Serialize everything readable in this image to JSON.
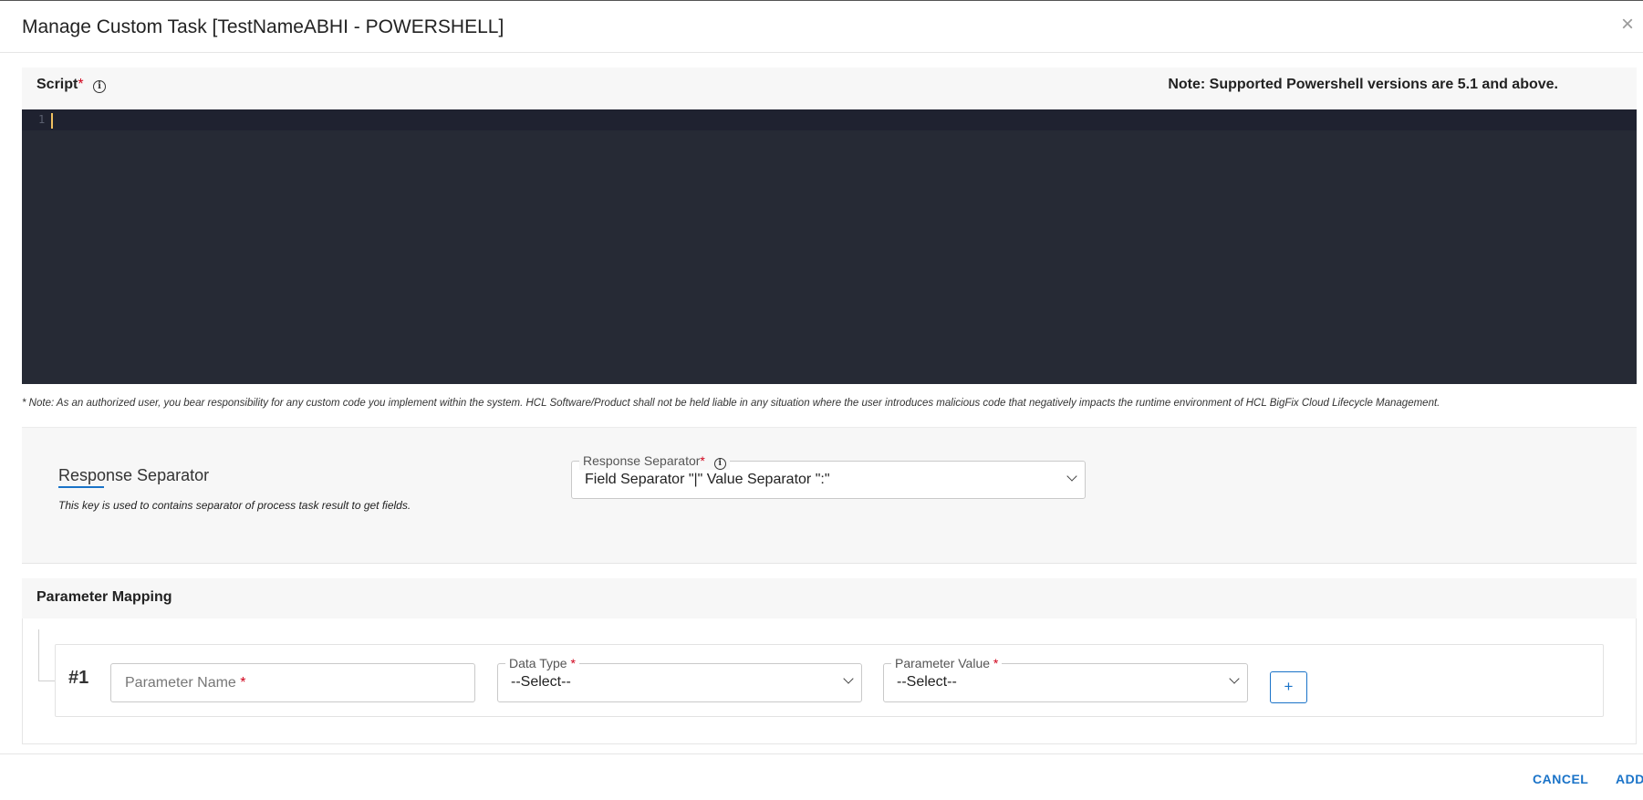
{
  "dialog": {
    "title": "Manage Custom Task [TestNameABHI - POWERSHELL]",
    "close_glyph": "×"
  },
  "script": {
    "label": "Script",
    "required_marker": "*",
    "info_glyph": "i",
    "version_note": "Note: Supported Powershell versions are 5.1 and above.",
    "editor": {
      "line_numbers": [
        "1"
      ],
      "content": ""
    },
    "disclaimer": "* Note: As an authorized user, you bear responsibility for any custom code you implement within the system. HCL Software/Product shall not be held liable in any situation where the user introduces malicious code that negatively impacts the runtime environment of HCL BigFix Cloud Lifecycle Management."
  },
  "response_separator": {
    "title": "Response Separator",
    "description": "This key is used to contains separator of process task result to get fields.",
    "field_label": "Response Separator",
    "required_marker": "*",
    "selected": "Field Separator \"|\" Value Separator \":\""
  },
  "parameter_mapping": {
    "title": "Parameter Mapping",
    "rows": [
      {
        "index_label": "#1",
        "name_placeholder": "Parameter Name",
        "data_type_label": "Data Type",
        "data_type_value": "--Select--",
        "param_value_label": "Parameter Value",
        "param_value_value": "--Select--"
      }
    ],
    "required_marker": "*",
    "add_row_glyph": "+"
  },
  "footer": {
    "cancel_label": "CANCEL",
    "add_label": "ADD"
  },
  "colors": {
    "accent": "#1a73c8",
    "required": "#d0021b",
    "editor_bg": "#262a35"
  },
  "icons": [
    "close-icon",
    "info-icon",
    "chevron-down-icon",
    "plus-icon"
  ]
}
